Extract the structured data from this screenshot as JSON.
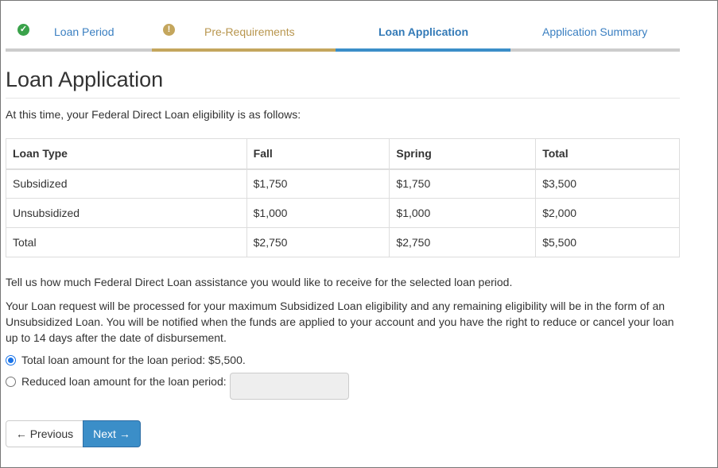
{
  "steps": [
    {
      "label": "Loan Period",
      "icon": "check-icon",
      "status": "complete",
      "color": "#3aa24a"
    },
    {
      "label": "Pre-Requirements",
      "icon": "alert-icon",
      "status": "warning",
      "color": "#c4a65d"
    },
    {
      "label": "Loan Application",
      "status": "current",
      "color": "#3b8ec8"
    },
    {
      "label": "Application Summary",
      "status": "upcoming"
    }
  ],
  "page": {
    "title": "Loan Application",
    "intro": "At this time, your Federal Direct Loan eligibility is as follows:"
  },
  "table": {
    "headers": [
      "Loan Type",
      "Fall",
      "Spring",
      "Total"
    ],
    "rows": [
      [
        "Subsidized",
        "$1,750",
        "$1,750",
        "$3,500"
      ],
      [
        "Unsubsidized",
        "$1,000",
        "$1,000",
        "$2,000"
      ],
      [
        "Total",
        "$2,750",
        "$2,750",
        "$5,500"
      ]
    ]
  },
  "instructions": {
    "prompt": "Tell us how much Federal Direct Loan assistance you would like to receive for the selected loan period.",
    "details": "Your Loan request will be processed for your maximum Subsidized Loan eligibility and any remaining eligibility will be in the form of an Unsubsidized Loan. You will be notified when the funds are applied to your account and you have the right to reduce or cancel your loan up to 14 days after the date of disbursement."
  },
  "options": {
    "total_label": "Total loan amount for the loan period: $5,500.",
    "reduced_label": "Reduced loan amount for the loan period:",
    "reduced_value": "",
    "selected": "total"
  },
  "buttons": {
    "previous": "← Previous",
    "next": "Next →"
  },
  "colors": {
    "accent": "#3b8ec8",
    "warning": "#c4a65d",
    "success": "#3aa24a"
  }
}
